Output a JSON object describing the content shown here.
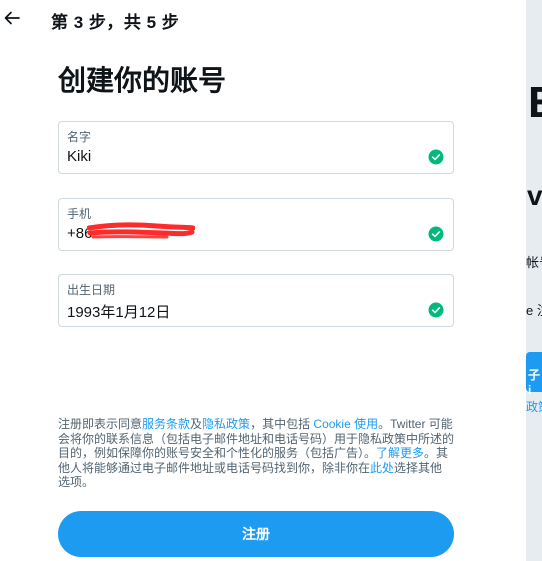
{
  "header": {
    "step_label": "第 3 步，共 5 步"
  },
  "title": "创建你的账号",
  "fields": {
    "name": {
      "label": "名字",
      "value": "Kiki",
      "status_icon": "check-circle-icon"
    },
    "phone": {
      "label": "手机",
      "value": "+86",
      "status_icon": "check-circle-icon"
    },
    "birthdate": {
      "label": "出生日期",
      "value": "1993年1月12日",
      "status_icon": "check-circle-icon"
    }
  },
  "terms": {
    "t1": "注册即表示同意",
    "link_terms": "服务条款",
    "t2": "及",
    "link_privacy": "隐私政策",
    "t3": "，其中包括 ",
    "link_cookie": "Cookie 使用",
    "t4": "。Twitter 可能会将你的联系信息（包括电子邮件地址和电话号码）用于隐私政策中所述的目的，例如保障你的账号安全和个性化的服务（包括广告）。",
    "link_learn": "了解更多",
    "t5": "。其他人将能够通过电子邮件地址或电话号码找到你，除非你在",
    "link_here": "此处",
    "t6": "选择其他选项。"
  },
  "signup_label": "注册",
  "background_page": {
    "big_text": "E",
    "mid_text": "vi",
    "line1": "帐号",
    "line2": "e 注",
    "button_text": "子i",
    "link_text": "政策"
  },
  "colors": {
    "accent": "#1d9bf0",
    "check": "#00ba7c",
    "text": "#0f1419",
    "secondary": "#536471",
    "border": "#cfd9de"
  }
}
